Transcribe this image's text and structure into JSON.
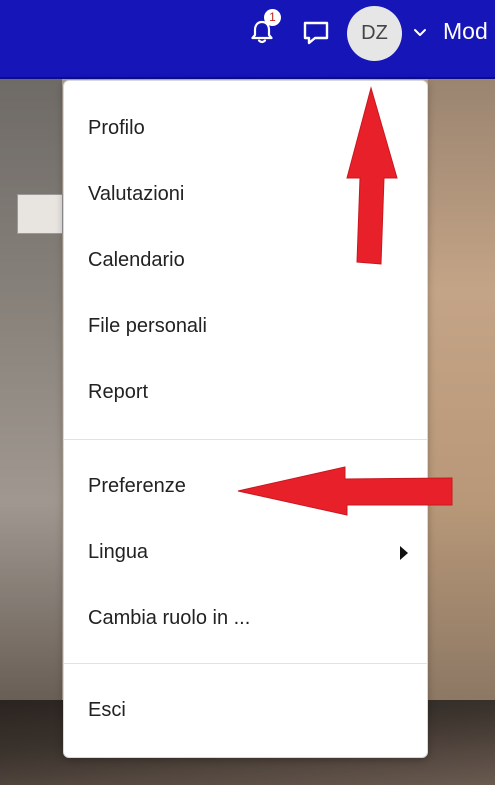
{
  "navbar": {
    "notification_icon": "bell-icon",
    "notification_count": "1",
    "messages_icon": "chat-bubble-icon",
    "avatar_initials": "DZ",
    "user_menu_icon": "chevron-down-icon",
    "mode_label": "Mod",
    "background_color": "#1515b8"
  },
  "user_menu": {
    "group1": [
      {
        "label": "Profilo"
      },
      {
        "label": "Valutazioni"
      },
      {
        "label": "Calendario"
      },
      {
        "label": "File personali"
      },
      {
        "label": "Report"
      }
    ],
    "group2": [
      {
        "label": "Preferenze"
      },
      {
        "label": "Lingua",
        "submenu_icon": "caret-right-icon"
      },
      {
        "label": "Cambia ruolo in ..."
      }
    ],
    "group3": [
      {
        "label": "Esci"
      }
    ]
  },
  "annotations": {
    "arrow_color": "#e8202a",
    "arrows": [
      "arrow-up-to-avatar",
      "arrow-left-to-preferenze"
    ]
  }
}
